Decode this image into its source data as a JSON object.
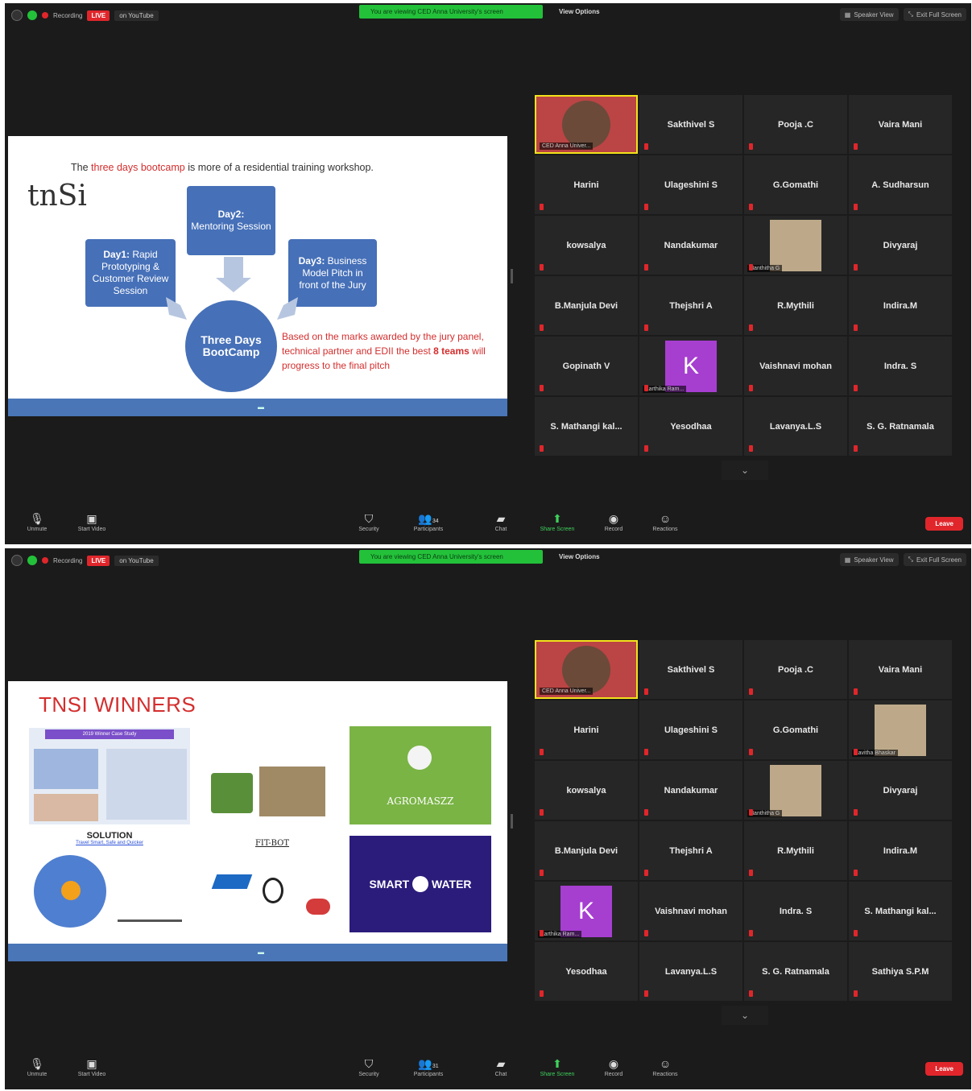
{
  "colors": {
    "live": "#e0262b",
    "banner": "#23c13a",
    "slide_blue": "#4670b8",
    "slide_red": "#d42e2e",
    "active_speaker_border": "#f2e21a",
    "avatar_purple": "#a63ed0"
  },
  "header": {
    "recording": "Recording",
    "live": "LIVE",
    "youtube": "on YouTube",
    "banner": "You are viewing CED Anna University's screen",
    "view_options": "View Options",
    "speaker_view": "Speaker View",
    "exit_full": "Exit Full Screen"
  },
  "toolbar": {
    "unmute": "Unmute",
    "start_video": "Start Video",
    "security": "Security",
    "participants": "Participants",
    "participants_count_1": "34",
    "participants_count_2": "31",
    "chat": "Chat",
    "share": "Share Screen",
    "record": "Record",
    "reactions": "Reactions",
    "leave": "Leave"
  },
  "slide1": {
    "title_pre": "The ",
    "title_red": "three days bootcamp",
    "title_post": " is more of a residential training workshop.",
    "logo": "tnSi",
    "day1_head": "Day1:",
    "day1_text": " Rapid Prototyping & Customer Review Session",
    "day2_head": "Day2:",
    "day2_text": "Mentoring Session",
    "day3_head": "Day3:",
    "day3_text": " Business Model Pitch in front of the Jury",
    "center": "Three Days BootCamp",
    "note_pre": "Based on the marks awarded by the jury panel, technical partner and EDII the best ",
    "note_bold": "8 teams",
    "note_post": " will progress to the final pitch"
  },
  "slide2": {
    "title": "TNSI WINNERS",
    "case_study": "2019 Winner Case Study",
    "solution": "SOLUTION",
    "solution_sub": "Travel Smart, Safe and Quicker",
    "fitbot": "FIT-BOT",
    "agriwaste": "AGROMASZZ",
    "smart_water": "SMART",
    "smart_water2": "WATER"
  },
  "grid1": [
    {
      "type": "video",
      "caption": "CED Anna Univer..."
    },
    {
      "name": "Sakthivel S"
    },
    {
      "name": "Pooja .C"
    },
    {
      "name": "Vaira Mani"
    },
    {
      "name": "Harini"
    },
    {
      "name": "Ulageshini S"
    },
    {
      "name": "G.Gomathi"
    },
    {
      "name": "A. Sudharsun"
    },
    {
      "name": "kowsalya"
    },
    {
      "name": "Nandakumar"
    },
    {
      "type": "photo",
      "caption": "Nanthitha G"
    },
    {
      "name": "Divyaraj"
    },
    {
      "name": "B.Manjula Devi"
    },
    {
      "name": "Thejshri A"
    },
    {
      "name": "R.Mythili"
    },
    {
      "name": "Indira.M"
    },
    {
      "name": "Gopinath V"
    },
    {
      "type": "avatar",
      "letter": "K",
      "caption": "Karthika Ram..."
    },
    {
      "name": "Vaishnavi mohan"
    },
    {
      "name": "Indra. S"
    },
    {
      "name": "S. Mathangi kal..."
    },
    {
      "name": "Yesodhaa"
    },
    {
      "name": "Lavanya.L.S"
    },
    {
      "name": "S. G. Ratnamala"
    }
  ],
  "grid2": [
    {
      "type": "video",
      "caption": "CED Anna Univer..."
    },
    {
      "name": "Sakthivel S"
    },
    {
      "name": "Pooja .C"
    },
    {
      "name": "Vaira Mani"
    },
    {
      "name": "Harini"
    },
    {
      "name": "Ulageshini S"
    },
    {
      "name": "G.Gomathi"
    },
    {
      "type": "photo",
      "caption": "Kavitha Bhaskar"
    },
    {
      "name": "kowsalya"
    },
    {
      "name": "Nandakumar"
    },
    {
      "type": "photo",
      "caption": "Nanthitha G"
    },
    {
      "name": "Divyaraj"
    },
    {
      "name": "B.Manjula Devi"
    },
    {
      "name": "Thejshri A"
    },
    {
      "name": "R.Mythili"
    },
    {
      "name": "Indira.M"
    },
    {
      "type": "avatar",
      "letter": "K",
      "caption": "Karthika Ram..."
    },
    {
      "name": "Vaishnavi mohan"
    },
    {
      "name": "Indra. S"
    },
    {
      "name": "S. Mathangi kal..."
    },
    {
      "name": "Yesodhaa"
    },
    {
      "name": "Lavanya.L.S"
    },
    {
      "name": "S. G. Ratnamala"
    },
    {
      "name": "Sathiya S.P.M"
    }
  ]
}
